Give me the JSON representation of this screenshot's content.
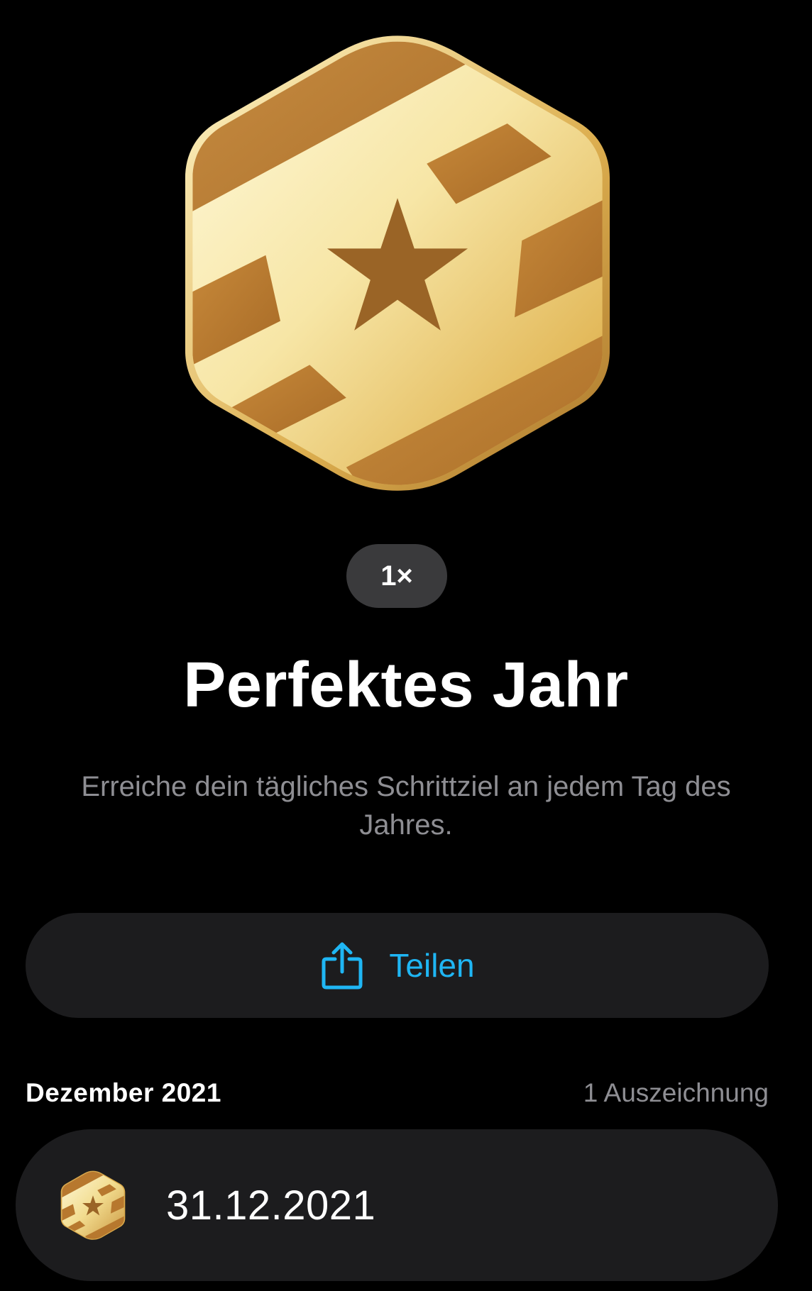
{
  "badge": {
    "icon": "perfect-year-badge-icon",
    "colors": {
      "gold_light": "#fbf3c4",
      "gold_mid": "#e6c167",
      "gold_dark": "#b98432",
      "stripe": "#b7782e",
      "star": "#9a6426"
    },
    "count_label": "1×"
  },
  "title": "Perfektes Jahr",
  "description": "Erreiche dein tägliches Schrittziel an jedem Tag des Jahres.",
  "share": {
    "icon": "share-icon",
    "label": "Teilen",
    "color": "#1fb6f4"
  },
  "section": {
    "title": "Dezember 2021",
    "count": "1 Auszeichnung"
  },
  "awards": [
    {
      "icon": "perfect-year-badge-icon",
      "date": "31.12.2021"
    }
  ]
}
